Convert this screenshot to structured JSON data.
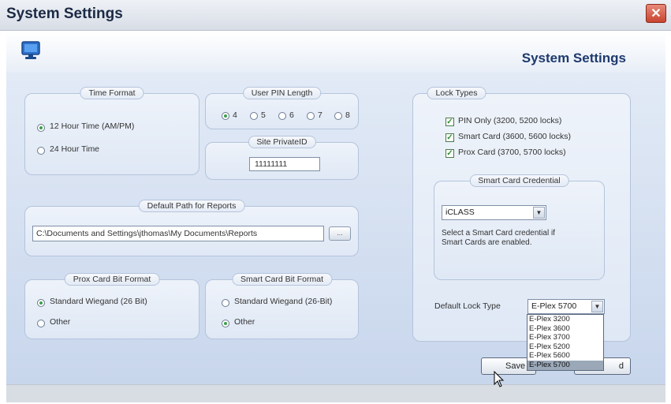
{
  "window": {
    "title": "System Settings",
    "close_glyph": "✕"
  },
  "header": {
    "title": "System Settings",
    "icon": "monitor-icon"
  },
  "time_format": {
    "label": "Time Format",
    "options": [
      "12 Hour Time (AM/PM)",
      "24 Hour Time"
    ],
    "selected": "12 Hour Time (AM/PM)"
  },
  "pin_length": {
    "label": "User PIN Length",
    "options": [
      "4",
      "5",
      "6",
      "7",
      "8"
    ],
    "selected": "4"
  },
  "site_private_id": {
    "label": "Site PrivateID",
    "value": "11111111"
  },
  "reports_path": {
    "label": "Default Path for Reports",
    "value": "C:\\Documents and Settings\\jthomas\\My Documents\\Reports",
    "browse_label": "..."
  },
  "prox_format": {
    "label": "Prox Card Bit Format",
    "options": [
      "Standard Wiegand (26 Bit)",
      "Other"
    ],
    "selected": "Standard Wiegand (26 Bit)"
  },
  "smart_format": {
    "label": "Smart Card Bit Format",
    "options": [
      "Standard Wiegand (26-Bit)",
      "Other"
    ],
    "selected": "Other"
  },
  "lock_types": {
    "label": "Lock Types",
    "items": [
      {
        "label": "PIN Only (3200, 5200 locks)",
        "checked": true
      },
      {
        "label": "Smart Card (3600, 5600 locks)",
        "checked": true
      },
      {
        "label": "Prox Card (3700, 5700 locks)",
        "checked": true
      }
    ]
  },
  "smart_credential": {
    "label": "Smart Card Credential",
    "value": "iCLASS",
    "help_line1": "Select a Smart Card credential if",
    "help_line2": "Smart Cards are enabled."
  },
  "default_lock": {
    "label": "Default Lock Type",
    "value": "E-Plex 5700",
    "options": [
      "E-Plex 3200",
      "E-Plex 3600",
      "E-Plex 3700",
      "E-Plex 5200",
      "E-Plex 5600",
      "E-Plex 5700"
    ],
    "highlighted": "E-Plex 5700"
  },
  "buttons": {
    "save": "Save",
    "cancel_fragment": "d"
  },
  "colors": {
    "accent": "#1e3a6e",
    "panel": "#dfe8f5",
    "close": "#c8442e",
    "radio_on": "#3aa04a"
  }
}
